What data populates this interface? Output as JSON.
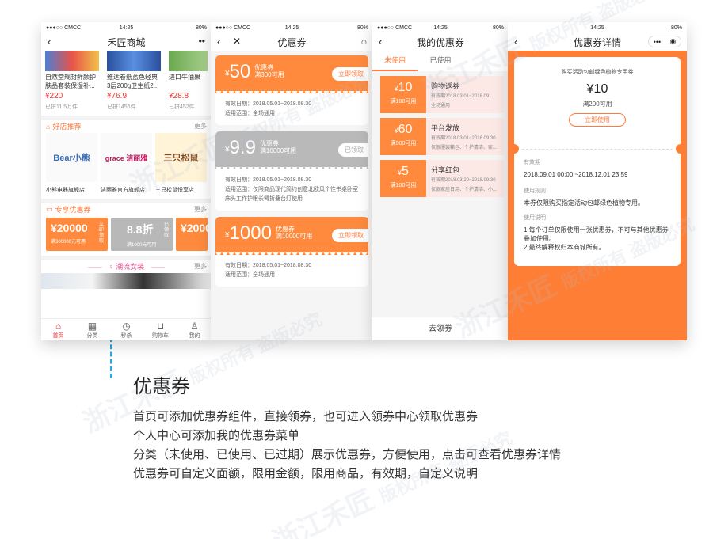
{
  "status": {
    "carrier": "●●●○○ CMCC",
    "time": "14:25",
    "battery": "80%"
  },
  "phone1": {
    "title": "禾匠商城",
    "products": [
      {
        "name": "自然堂规封鲜颜护肤品套装保湿补...",
        "price": "¥220",
        "sold": "已拼11.5万件"
      },
      {
        "name": "维达卷纸蓝色经典3层200g卫生纸2...",
        "price": "¥76.9",
        "sold": "已拼1456件"
      },
      {
        "name": "进口牛油果",
        "price": "¥28.8",
        "sold": "已拼452件"
      }
    ],
    "shops_section": {
      "title": "好店推荐",
      "more": "更多"
    },
    "shops": [
      {
        "logo": "Bear小熊",
        "name": "小熊电器旗舰店"
      },
      {
        "logo": "grace 洁丽雅",
        "name": "洁丽雅官方旗舰店"
      },
      {
        "logo": "三只松鼠",
        "name": "三只松鼠悦享店"
      }
    ],
    "exclusive_section": {
      "title": "专享优惠券",
      "more": "更多"
    },
    "exclusive": [
      {
        "value": "¥20000",
        "desc": "满300000元可用",
        "btn": "立即领取"
      },
      {
        "value": "8.8折",
        "desc": "满1000元可用",
        "btn": "已领取"
      },
      {
        "value": "¥2000",
        "desc": "",
        "btn": ""
      }
    ],
    "fashion": {
      "title": "潮流女装",
      "more": "更多"
    },
    "tabs": [
      {
        "icon": "⌂",
        "label": "首页"
      },
      {
        "icon": "▦",
        "label": "分类"
      },
      {
        "icon": "◷",
        "label": "秒杀"
      },
      {
        "icon": "⊔",
        "label": "购物车"
      },
      {
        "icon": "♙",
        "label": "我的"
      }
    ]
  },
  "phone2": {
    "title": "优惠券",
    "coupons": [
      {
        "currency": "¥",
        "amount": "50",
        "type": "优惠券",
        "cond": "满300可用",
        "btn": "立即领取",
        "period": "有效日期：2018.05.01~2018.08.30",
        "scope": "适用范围：全场通用",
        "grey": false
      },
      {
        "currency": "¥",
        "amount": "9.9",
        "type": "优惠券",
        "cond": "满10000可用",
        "btn": "已领取",
        "period": "有效日期：2018.05.01~2018.08.30",
        "scope": "适用范围：仅限商品现代简约创意北欧风个性书桌卧室床头工作护眼长臂折叠台灯使用",
        "grey": true
      },
      {
        "currency": "¥",
        "amount": "1000",
        "type": "优惠券",
        "cond": "满10000可用",
        "btn": "立即领取",
        "period": "有效日期：2018.05.01~2018.08.30",
        "scope": "适用范围：全场通用",
        "grey": false
      }
    ]
  },
  "phone3": {
    "title": "我的优惠券",
    "tabs": [
      "未使用",
      "已使用"
    ],
    "coupons": [
      {
        "amount": "10",
        "cond": "满100可用",
        "name": "购物返券",
        "period": "有效期2018.03.01~2018.09...",
        "scope": "全场通用"
      },
      {
        "amount": "60",
        "cond": "满500可用",
        "name": "平台发放",
        "period": "有效期2018.03.01~2018.09.30",
        "scope": "仅限服装箱包、个护清洁、家..."
      },
      {
        "amount": "5",
        "cond": "满100可用",
        "name": "分享红包",
        "period": "有效期2018.03.20~2018.09.30",
        "scope": "仅限家居日用、个护清洁、小..."
      }
    ],
    "bottom": "去领券"
  },
  "phone4": {
    "title": "优惠券详情",
    "card_title": "购买活动包邮绿色植物专用券",
    "amount": "¥10",
    "cond": "满200可用",
    "btn": "立即使用",
    "valid_label": "有效期",
    "valid_value": "2018.09.01 00:00 ~2018.12.01 23:59",
    "rule_label": "使用规则",
    "rule_value": "本券仅限购买指定活动包邮绿色植物专用。",
    "note_label": "使用说明",
    "note_lines": [
      "1.每个订单仅限使用一张优惠券，不可与其他优惠券叠加使用。",
      "2.最终解释权归本商城所有。"
    ]
  },
  "section": {
    "title": "优惠券",
    "lines": [
      "首页可添加优惠券组件，直接领券，也可进入领券中心领取优惠券",
      "个人中心可添加我的优惠券菜单",
      "分类（未使用、已使用、已过期）展示优惠券，方便使用，点击可查看优惠券详情",
      "优惠券可自定义面额，限用金额，限用商品，有效期，自定义说明"
    ]
  },
  "watermark": {
    "brand": "浙江禾匠",
    "notice": "版权所有 盗版必究"
  }
}
